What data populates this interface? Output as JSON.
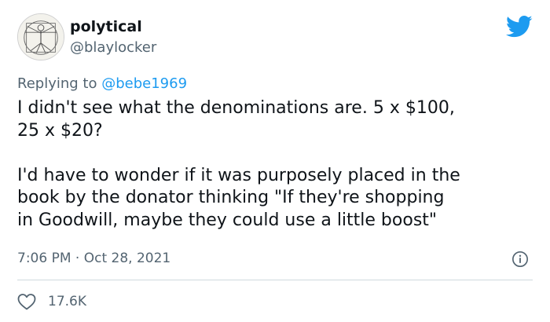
{
  "user": {
    "display_name": "polytical",
    "handle": "@blaylocker",
    "avatar_icon": "vitruvian-man-avatar"
  },
  "brand": {
    "logo_icon": "twitter-bird-icon",
    "color": "#1d9bf0"
  },
  "reply": {
    "prefix": "Replying to",
    "mention": "@bebe1969"
  },
  "tweet": {
    "line1": "I didn't see what the denominations are. 5 x $100,",
    "line2": "25 x $20?",
    "line3": "I'd have to wonder if it was purposely placed in the",
    "line4": "book by the donator thinking \"If they're shopping",
    "line5": "in Goodwill, maybe they could use a little boost\""
  },
  "meta": {
    "time": "7:06 PM",
    "separator": "·",
    "date": "Oct 28, 2021",
    "info_icon": "info-icon"
  },
  "engagement": {
    "like_icon": "heart-icon",
    "likes": "17.6K"
  }
}
